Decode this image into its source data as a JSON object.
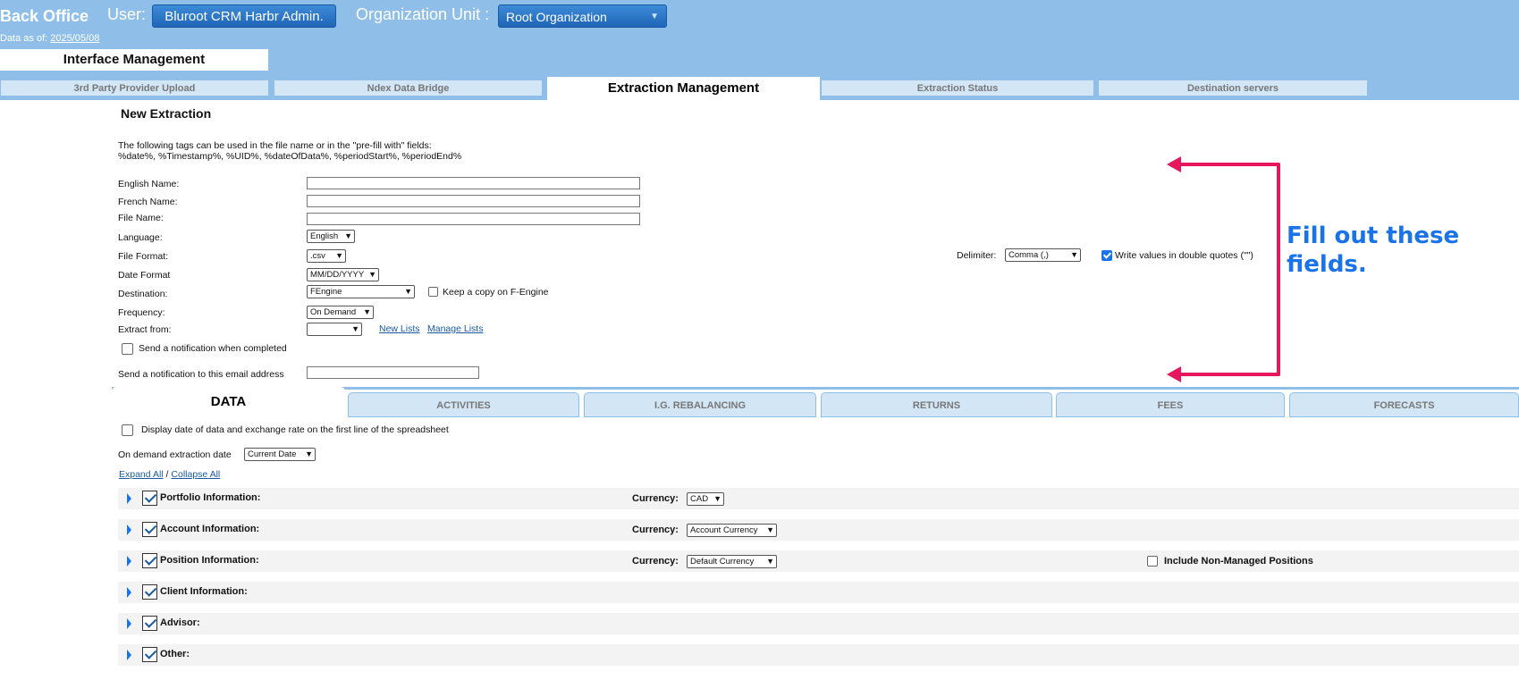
{
  "header": {
    "app_title": "Back Office",
    "user_label": "User:",
    "user_name": "Bluroot CRM Harbr Admin.",
    "org_label": "Organization Unit :",
    "org_value": "Root Organization",
    "data_as_of_label": "Data as of:",
    "data_as_of_date": "2025/05/08",
    "interface_tab": "Interface Management"
  },
  "tabs": [
    {
      "label": "3rd Party Provider Upload",
      "active": false
    },
    {
      "label": "Ndex Data Bridge",
      "active": false
    },
    {
      "label": "Extraction Management",
      "active": true
    },
    {
      "label": "Extraction Status",
      "active": false
    },
    {
      "label": "Destination servers",
      "active": false
    }
  ],
  "form": {
    "title": "New Extraction",
    "tags_line1": "The following tags can be used in the file name or in the \"pre-fill with\" fields:",
    "tags_line2": "%date%, %Timestamp%, %UID%, %dateOfData%, %periodStart%, %periodEnd%",
    "english_name_label": "English Name:",
    "english_name_value": "",
    "french_name_label": "French Name:",
    "french_name_value": "",
    "file_name_label": "File Name:",
    "file_name_value": "",
    "language_label": "Language:",
    "language_value": "English",
    "file_format_label": "File Format:",
    "file_format_value": ".csv",
    "date_format_label": "Date Format",
    "date_format_value": "MM/DD/YYYY",
    "destination_label": "Destination:",
    "destination_value": "FEngine",
    "keep_copy_label": "Keep a copy on F-Engine",
    "keep_copy_checked": false,
    "frequency_label": "Frequency:",
    "frequency_value": "On Demand",
    "extract_from_label": "Extract from:",
    "extract_from_value": "",
    "new_lists_link": "New Lists",
    "manage_lists_link": "Manage Lists",
    "notify_completed_label": "Send a notification when completed",
    "notify_completed_checked": false,
    "notify_email_label": "Send a notification to this email address",
    "notify_email_value": "",
    "delimiter_label": "Delimiter:",
    "delimiter_value": "Comma (,)",
    "double_quotes_label": "Write values in double quotes (\"\")",
    "double_quotes_checked": true
  },
  "annotation": {
    "line1": "Fill out these",
    "line2": "fields.",
    "color": "#e8175d",
    "text_color": "#1a73e8"
  },
  "data_tabs": [
    {
      "label": "DATA",
      "active": true
    },
    {
      "label": "ACTIVITIES",
      "active": false
    },
    {
      "label": "I.G. REBALANCING",
      "active": false
    },
    {
      "label": "RETURNS",
      "active": false
    },
    {
      "label": "FEES",
      "active": false
    },
    {
      "label": "FORECASTS",
      "active": false
    }
  ],
  "data_panel": {
    "display_date_label": "Display date of data and exchange rate on the first line of the spreadsheet",
    "display_date_checked": false,
    "on_demand_label": "On demand extraction date",
    "on_demand_value": "Current Date",
    "expand_all": "Expand All",
    "separator": "/",
    "collapse_all": "Collapse All",
    "currency_label": "Currency:",
    "include_non_managed_label": "Include Non-Managed Positions",
    "include_non_managed_checked": false,
    "sections": [
      {
        "label": "Portfolio Information:",
        "checked": true,
        "currency": "CAD"
      },
      {
        "label": "Account Information:",
        "checked": true,
        "currency": "Account Currency"
      },
      {
        "label": "Position Information:",
        "checked": true,
        "currency": "Default Currency"
      },
      {
        "label": "Client Information:",
        "checked": true
      },
      {
        "label": "Advisor:",
        "checked": true
      },
      {
        "label": "Other:",
        "checked": true
      }
    ]
  }
}
